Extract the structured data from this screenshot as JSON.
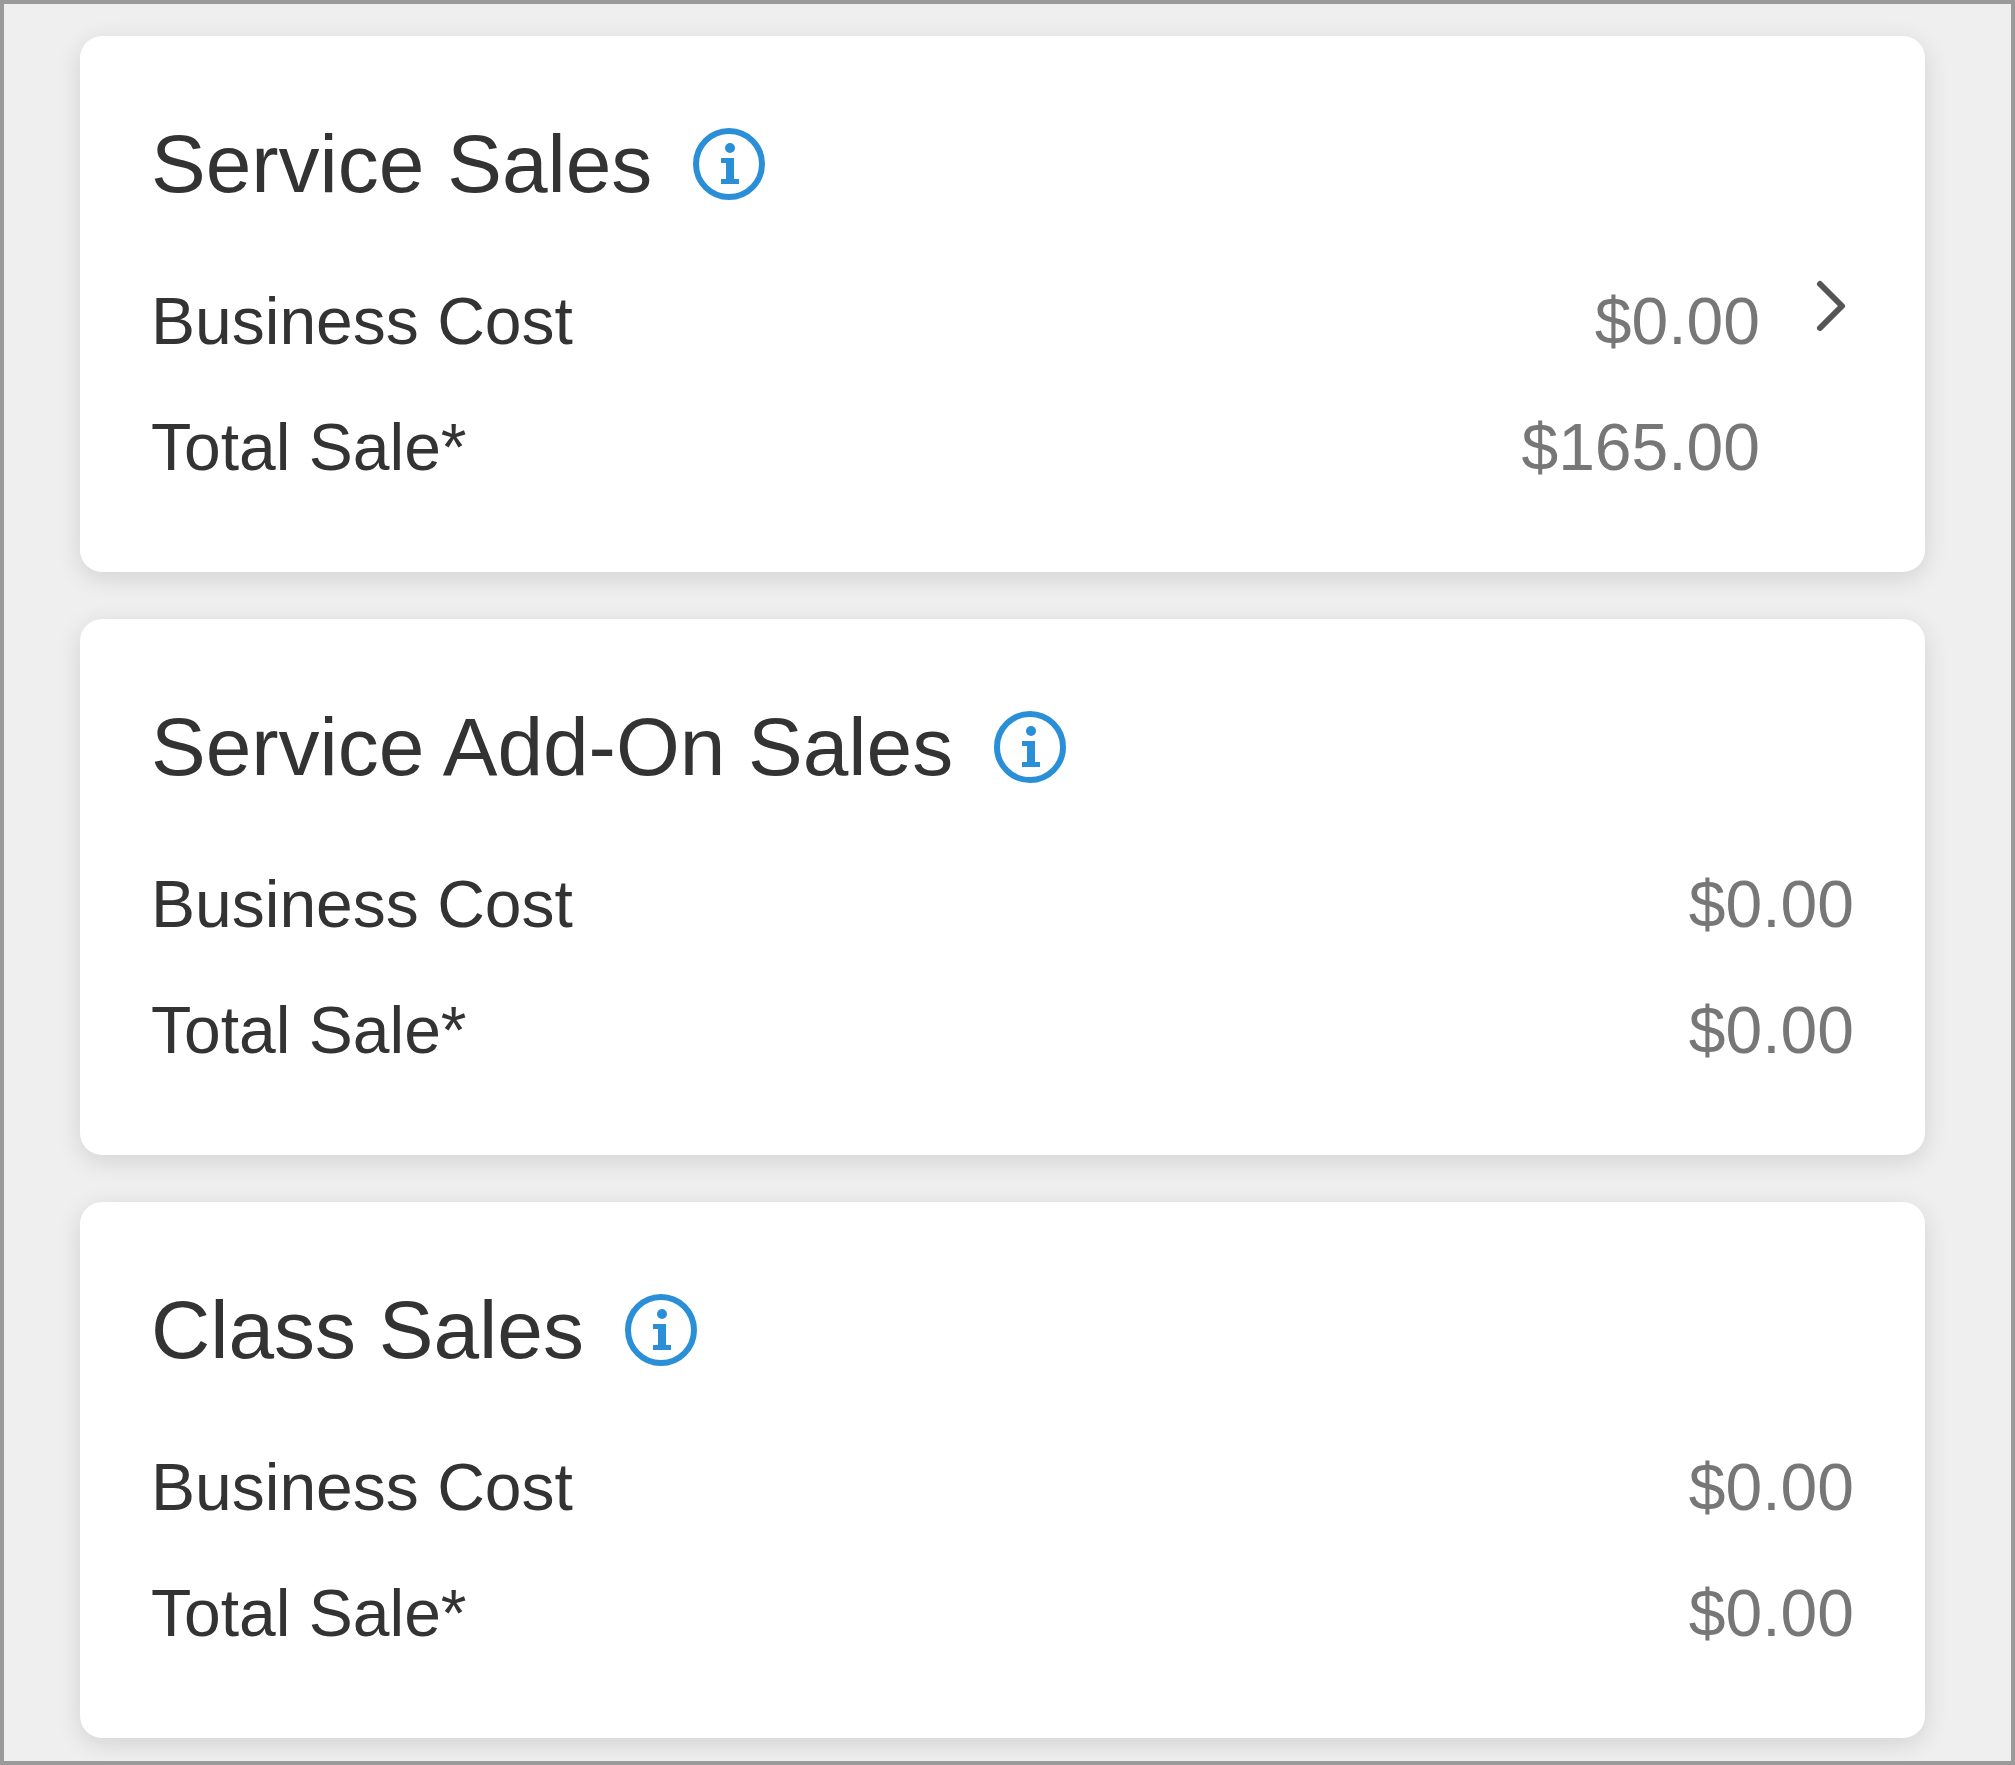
{
  "cards": [
    {
      "title": "Service Sales",
      "chevron": true,
      "rows": [
        {
          "label": "Business Cost",
          "value": "$0.00"
        },
        {
          "label": "Total Sale*",
          "value": "$165.00"
        }
      ]
    },
    {
      "title": "Service Add-On Sales",
      "chevron": false,
      "rows": [
        {
          "label": "Business Cost",
          "value": "$0.00"
        },
        {
          "label": "Total Sale*",
          "value": "$0.00"
        }
      ]
    },
    {
      "title": "Class Sales",
      "chevron": false,
      "rows": [
        {
          "label": "Business Cost",
          "value": "$0.00"
        },
        {
          "label": "Total Sale*",
          "value": "$0.00"
        }
      ]
    }
  ]
}
